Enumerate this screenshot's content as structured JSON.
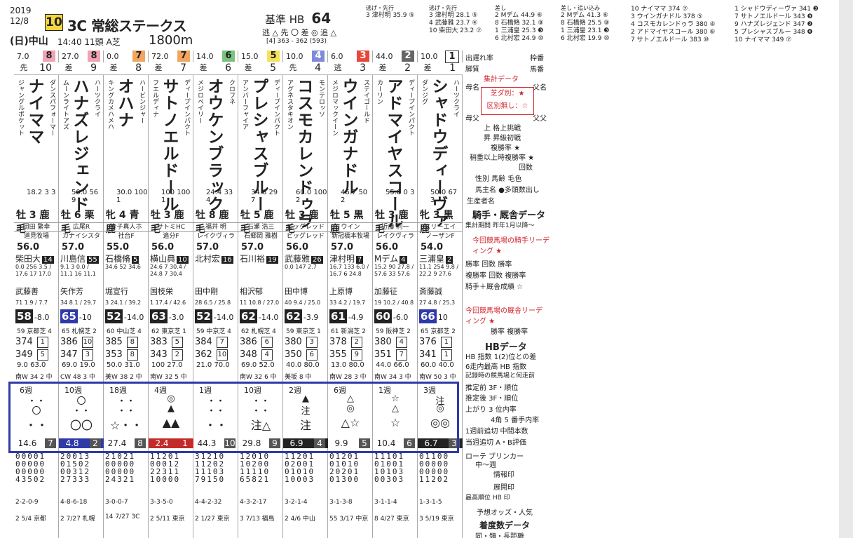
{
  "header": {
    "year": "2019",
    "date": "12/8",
    "race_no": "10",
    "race_class": "3C",
    "race_name": "常総ステークス",
    "venue": "(日)中山",
    "start": "14:40 11頭 A芝",
    "distance": "1800m",
    "kijun_label": "基準 HB",
    "kijun_value": "64",
    "legs": "逃 △ 先 〇 差 ◎ 追 △",
    "l4": "[4]   363 - 362  (593)"
  },
  "tables": {
    "t1": {
      "title": "逃げ・先行",
      "rows": [
        "3  津村明  35.9 ⑤"
      ]
    },
    "t2": {
      "title": "逃げ・先行",
      "rows": [
        "3  津村明  28.1 ⑤",
        "4  武藤雅  23.7 ④",
        "10  柴田大  23.2 ⑦"
      ]
    },
    "t3": {
      "title": "差し",
      "rows": [
        "2  Mデム  44.9 ⑥",
        "8  石橋脩  32.1 ⑧",
        "1  三浦皇  25.3 ❸",
        "6  北村宏  24.9 ⑩"
      ]
    },
    "t4": {
      "title": "差し・追い込み",
      "rows": [
        "2  Mデム  41.3 ⑥",
        "8  石橋脩  25.5 ⑧",
        "1  三浦皇  23.1 ❸",
        "6  北村宏  19.9 ⑩"
      ]
    },
    "t5": {
      "rows": [
        "10 ナイママ  374 ⑦",
        "3 ウインガナドル  378 ⑤",
        "4 コスモカレンドゥラ  380 ④",
        "2 アドマイヤスコール  380 ⑥",
        "7 サトノエルドール  383 ⑩"
      ]
    },
    "t6": {
      "rows": [
        "1 シャドウディーヴァ  341 ❸",
        "7 サトノエルドール  343 ❾",
        "9 ハナズレジェンド  347 ❷",
        "5 プレシャスブルー  348 ❹",
        "10 ナイママ  349 ⑦"
      ]
    }
  },
  "horses": [
    {
      "odds": "7.0",
      "gate": "8",
      "gate_color": "#f0a3b2",
      "style": "先",
      "num": "10",
      "name": "ナイママ",
      "sire": "ダンスパフォーマー",
      "dam": "ジャングルポケット",
      "stats": "18.2 3 3",
      "sex": "牡 3 鹿毛",
      "owner": "岡田 繁幸",
      "farm": "道見牧場",
      "weight": "56.0",
      "jockey": "柴田大",
      "jkn": "14",
      "jstats": "0.0 256 3.5 / 17.6 17 17.0",
      "trainer": "武藤善",
      "trnote": "71 1.9 / 7.7",
      "idx": "58",
      "idxd": "-8.0",
      "rank": "59 京都芝 4",
      "hb1": "374",
      "hbb1": "1",
      "hb2": "349",
      "hbb2": "5",
      "ag": "9.0   63.0",
      "train": "南W 34 2 中",
      "wk": "6週",
      "m1": "・・",
      "m2": "〇",
      "m3": "・・",
      "o": "14.6",
      "p": "7",
      "grid": "00001\n00000\n00000\n43502",
      "res": "2-2-0-9",
      "last": "2 5/4 京都"
    },
    {
      "odds": "27.0",
      "gate": "8",
      "gate_color": "#f0a3b2",
      "style": "差",
      "num": "9",
      "name": "ハナズレジェンド",
      "sire": "ハーツクライ",
      "dam": "ムーンライトアズ",
      "stats": "50.0 56 9",
      "sex": "牡 6 栗毛",
      "owner": "広尾R",
      "farm": "カナイシスタ",
      "weight": "57.0",
      "jockey": "川島信",
      "jkn": "55",
      "jstats": "9.1 3 0.0 / 11.1 16 11.1",
      "trainer": "矢作芳",
      "trnote": "34 8.1 / 29.7",
      "idx": "65",
      "idxd": "-10",
      "rank": "65 札幌芝 2",
      "hb1": "386",
      "hbb1": "10",
      "hb2": "347",
      "hbb2": "3",
      "ag": "69.0   19.0",
      "train": "CW 48 3 中",
      "wk": "10週",
      "m1": "〇",
      "m2": "・・",
      "m3": "〇〇",
      "o": "4.8",
      "p": "2",
      "grid": "20013\n01502\n00312\n27333",
      "res": "4-8-6-18",
      "last": "2 7/27 札幌"
    },
    {
      "odds": "0.0",
      "gate": "7",
      "gate_color": "#f2a55f",
      "style": "差",
      "num": "8",
      "name": "オハナ",
      "sire": "ハービンジャー",
      "dam": "キングカメハメハ",
      "stats": "30.0 100 1",
      "sex": "牝 4 青鹿",
      "owner": "金子真人ホ",
      "farm": "社台F",
      "weight": "55.0",
      "jockey": "石橋脩",
      "jkn": "5",
      "jstats": "34.6 52 34.6",
      "trainer": "堀宣行",
      "trnote": "3 24.1 / 39.2",
      "idx": "52",
      "idxd": "-14.0",
      "rank": "60 中山芝 4",
      "hb1": "385",
      "hbb1": "8",
      "hb2": "353",
      "hbb2": "8",
      "ag": "50.0   31.0",
      "train": "美W 38 2 中",
      "wk": "18週",
      "m1": "・・",
      "m2": "・・",
      "m3": "☆・・",
      "o": "27.4",
      "p": "8",
      "grid": "21021\n00000\n00000\n24321",
      "res": "3-0-0-7",
      "last": "14 7/27 3C"
    },
    {
      "odds": "72.0",
      "gate": "7",
      "gate_color": "#f2a55f",
      "style": "差",
      "num": "7",
      "name": "サトノエルドール",
      "sire": "ディープインパクト",
      "dam": "フエルディナ",
      "stats": "100 100 1",
      "sex": "牡 3 鹿毛",
      "owner": "サトミHC",
      "farm": "追分F",
      "weight": "56.0",
      "jockey": "横山典",
      "jkn": "10",
      "jstats": "24.6 7 30.4 / 24.8 7 30.4",
      "trainer": "国枝栄",
      "trnote": "1 17.4 / 42.6",
      "idx": "63",
      "idxd": "-3.0",
      "rank": "62 東京芝 1",
      "hb1": "383",
      "hbb1": "5",
      "hb2": "343",
      "hbb2": "2",
      "ag": "100   27.0",
      "train": "南W 32 5 中",
      "wk": "4週",
      "m1": "◎",
      "m2": "▲",
      "m3": "▲▲",
      "o": "2.4",
      "p": "1",
      "grid": "11201\n00012\n22311\n10000",
      "res": "3-3-5-0",
      "last": "2 5/11 東京"
    },
    {
      "odds": "14.0",
      "gate": "6",
      "gate_color": "#7ac27e",
      "style": "差",
      "num": "6",
      "name": "オウケンブラック",
      "sire": "クロフネ",
      "dam": "メジロベイリー",
      "stats": "24.4 33 4",
      "sex": "牡 8 鹿毛",
      "owner": "福井 明",
      "farm": "レイクヴィラ",
      "weight": "57.0",
      "jockey": "北村宏",
      "jkn": "16",
      "jstats": "",
      "trainer": "田中剛",
      "trnote": "28 6.5 / 25.8",
      "idx": "52",
      "idxd": "-14.0",
      "rank": "59 中京芝 4",
      "hb1": "384",
      "hbb1": "7",
      "hb2": "362",
      "hbb2": "10",
      "ag": "21.0   70.0",
      "train": "",
      "wk": "1週",
      "m1": "・・",
      "m2": "・・",
      "m3": "・・",
      "o": "44.3",
      "p": "10",
      "grid": "31210\n11202\n11103\n79150",
      "res": "4-4-2-32",
      "last": "2 1/27 東京"
    },
    {
      "odds": "15.0",
      "gate": "5",
      "gate_color": "#f6e15a",
      "style": "差",
      "num": "5",
      "name": "プレシャスブルー",
      "sire": "ディープインパクト",
      "dam": "アンバーフャイア",
      "stats": "34.6 29 7",
      "sex": "牡 5 鹿毛",
      "owner": "石瀬 浩三",
      "farm": "石郷岡 雅樹",
      "weight": "57.0",
      "jockey": "石川裕",
      "jkn": "19",
      "jstats": "",
      "trainer": "相沢郁",
      "trnote": "11 10.8 / 27.0",
      "idx": "62",
      "idxd": "-14.0",
      "rank": "62 札幌芝 4",
      "hb1": "386",
      "hbb1": "6",
      "hb2": "348",
      "hbb2": "4",
      "ag": "69.0   52.0",
      "train": "南W 32 6 中",
      "wk": "10週",
      "m1": "・・",
      "m2": "・・",
      "m3": "注△",
      "o": "29.8",
      "p": "9",
      "grid": "12010\n10200\n11110\n65821",
      "res": "4-3-2-17",
      "last": "3 7/13 福島"
    },
    {
      "odds": "10.0",
      "gate": "4",
      "gate_color": "#7f8bd8",
      "style": "先",
      "num": "4",
      "name": "コスモカレンドゥラ",
      "sire": "モンテロッソ",
      "dam": "アグネスタキオン",
      "stats": "60.0 100 2",
      "sex": "牡 3 鹿毛",
      "owner": "ビッグレッド",
      "farm": "ビッグレッド",
      "weight": "56.0",
      "jockey": "武藤雅",
      "jkn": "26",
      "jstats": "0.0 147 2.7",
      "trainer": "田中博",
      "trnote": "40 9.4 / 25.0",
      "idx": "62",
      "idxd": "-3.9",
      "rank": "59 東京芝 1",
      "hb1": "380",
      "hbb1": "3",
      "hb2": "350",
      "hbb2": "6",
      "ag": "40.0   80.0",
      "train": "美坂 8 中",
      "wk": "2週",
      "m1": "▲",
      "m2": "注",
      "m3": "注",
      "o": "6.9",
      "p": "4",
      "grid": "11201\n02001\n01010\n10003",
      "res": "3-2-1-4",
      "last": "2 4/6 中山"
    },
    {
      "odds": "6.0",
      "gate": "3",
      "gate_color": "#e8473a",
      "style": "逃",
      "num": "3",
      "name": "ウインガナドル",
      "sire": "ステイゴールド",
      "dam": "メジロマックイーン",
      "stats": "46.7 50 2",
      "sex": "牡 5 黒鹿",
      "owner": "ウイン",
      "farm": "新冠橋本牧場",
      "weight": "57.0",
      "jockey": "津村明",
      "jkn": "7",
      "jstats": "16.7 133 6.0 / 16.7 6 24.8",
      "trainer": "上原博",
      "trnote": "33 4.2 / 19.7",
      "idx": "61",
      "idxd": "-4.9",
      "rank": "61 新潟芝 2",
      "hb1": "378",
      "hbb1": "2",
      "hb2": "355",
      "hbb2": "9",
      "ag": "13.0   80.0",
      "train": "南W 28 3 中",
      "wk": "6週",
      "m1": "△",
      "m2": "◎",
      "m3": "△☆",
      "o": "9.9",
      "p": "5",
      "grid": "01201\n01010\n20201\n01300",
      "res": "3-1-3-8",
      "last": "55 3/17 中京"
    },
    {
      "odds": "44.0",
      "gate": "2",
      "gate_color": "#666666",
      "style": "差",
      "num": "2",
      "name": "アドマイヤスコール",
      "sire": "ディープインパクト",
      "dam": "カーリン",
      "stats": "55.6 0 3",
      "sex": "牡 3 鹿毛",
      "owner": "近藤 利一",
      "farm": "レイクヴィラ",
      "weight": "56.0",
      "jockey": "Mデム",
      "jkn": "4",
      "jstats": "15.2 90 27.8 / 57.6 33 57.6",
      "trainer": "加藤征",
      "trnote": "19 10.2 / 40.8",
      "idx": "60",
      "idxd": "-6.0",
      "rank": "59 阪神芝 2",
      "hb1": "380",
      "hbb1": "4",
      "hb2": "351",
      "hbb2": "7",
      "ag": "44.0   66.0",
      "train": "南W 34 3 中",
      "wk": "1週",
      "m1": "☆",
      "m2": "△",
      "m3": "☆",
      "o": "10.4",
      "p": "6",
      "grid": "11101\n01001\n10103\n00303",
      "res": "3-1-1-4",
      "last": "8 4/27 東京"
    },
    {
      "odds": "10.0",
      "gate": "1",
      "gate_color": "#ffffff",
      "style": "差",
      "num": "1",
      "name": "シャドウディーヴァ",
      "sire": "ハーツクライ",
      "dam": "ダンジグ",
      "stats": "50.0 67 3",
      "sex": "牝 3 黒鹿",
      "owner": "スリーエイ",
      "farm": "ノーザンF",
      "weight": "54.0",
      "jockey": "三浦皇",
      "jkn": "2",
      "jstats": "11.1 254 9.8 / 22.2 9 27.6",
      "trainer": "斎藤誠",
      "trnote": "27 4.8 / 25.3",
      "idx": "66",
      "idxd": "10",
      "rank": "65 京都芝 2",
      "hb1": "376",
      "hbb1": "1",
      "hb2": "341",
      "hbb2": "1",
      "ag": "60.0   40.0",
      "train": "南W 50 3 中",
      "wk": "3週",
      "m1": "注",
      "m2": "◎",
      "m3": "◎◎",
      "o": "6.7",
      "p": "3",
      "grid": "01100\n00000\n00000\n11202",
      "res": "1-3-1-5",
      "last": "3 5/19 東京"
    }
  ],
  "side": {
    "l1": "出遅れ率",
    "l1r": "枠番",
    "l2": "脚質",
    "l2r": "馬番",
    "box_title": "集計データ",
    "box1": "芝ダ別：★",
    "box2": "区別無し：☆",
    "l3": "母名",
    "l3r": "父名",
    "l4": "母父",
    "l4r": "父父",
    "l5": "上 格上挑戦",
    "l6": "昇 昇級初戦",
    "l7": "複勝率 ★",
    "l8": "稍重以上時複勝率 ★",
    "l9": "回数",
    "l10": "性別  馬齢  毛色",
    "l11": "馬主名 ●多頭数出し",
    "l12": "生産者名",
    "sec1": "騎手・厩舎データ",
    "l13": "集計期間 昨年1月以降〜",
    "l14": "今回競馬場の騎手リーディング ★",
    "l15": "勝率  回数 勝率",
    "l16": "複勝率 回数 複勝率",
    "l17": "騎手＋厩舎成績 ☆",
    "l18": "今回競馬場の厩舎リーディング ★",
    "l19": "勝率  複勝率",
    "sec2": "HBデータ",
    "l20": "HB 指数 1(2)位との差",
    "l21": "6走内最高 HB 指数",
    "l22": "記録時の競馬場と何走前",
    "l23": "推定前 3F・順位",
    "l24": "推定後 3F・順位",
    "l25": "上がり 3 位内率",
    "l26": "4角 5 番手内率",
    "l27": "1週前追切  中間本数",
    "l28": "当週追切  A・B評価",
    "l29": "ローテ  ブリンカー",
    "l30": "中〜週",
    "l31": "情報印",
    "l32": "展開印",
    "l33": "最高順位 HB 印",
    "l34": "予想オッズ・人気",
    "sec3": "着度数データ",
    "l35": "同・類・長距離"
  }
}
